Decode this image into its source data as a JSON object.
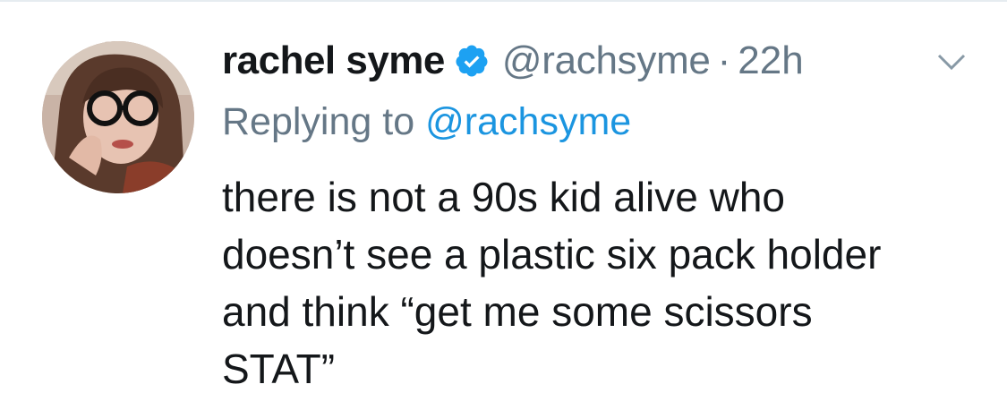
{
  "tweet": {
    "display_name": "rachel syme",
    "verified_icon": "verified-badge-icon",
    "handle": "@rachsyme",
    "separator": "·",
    "time": "22h",
    "menu_icon": "chevron-down-icon",
    "reply_prefix": "Replying to",
    "reply_to": "@rachsyme",
    "text_lines": [
      "there is not a 90s kid alive who",
      "doesn’t see a plastic six pack holder",
      "and think “get me some scissors",
      "STAT”"
    ]
  },
  "colors": {
    "name": "#14171a",
    "secondary": "#657786",
    "link": "#1b95e0",
    "verified": "#1da1f2",
    "divider": "#e6ecf0"
  }
}
